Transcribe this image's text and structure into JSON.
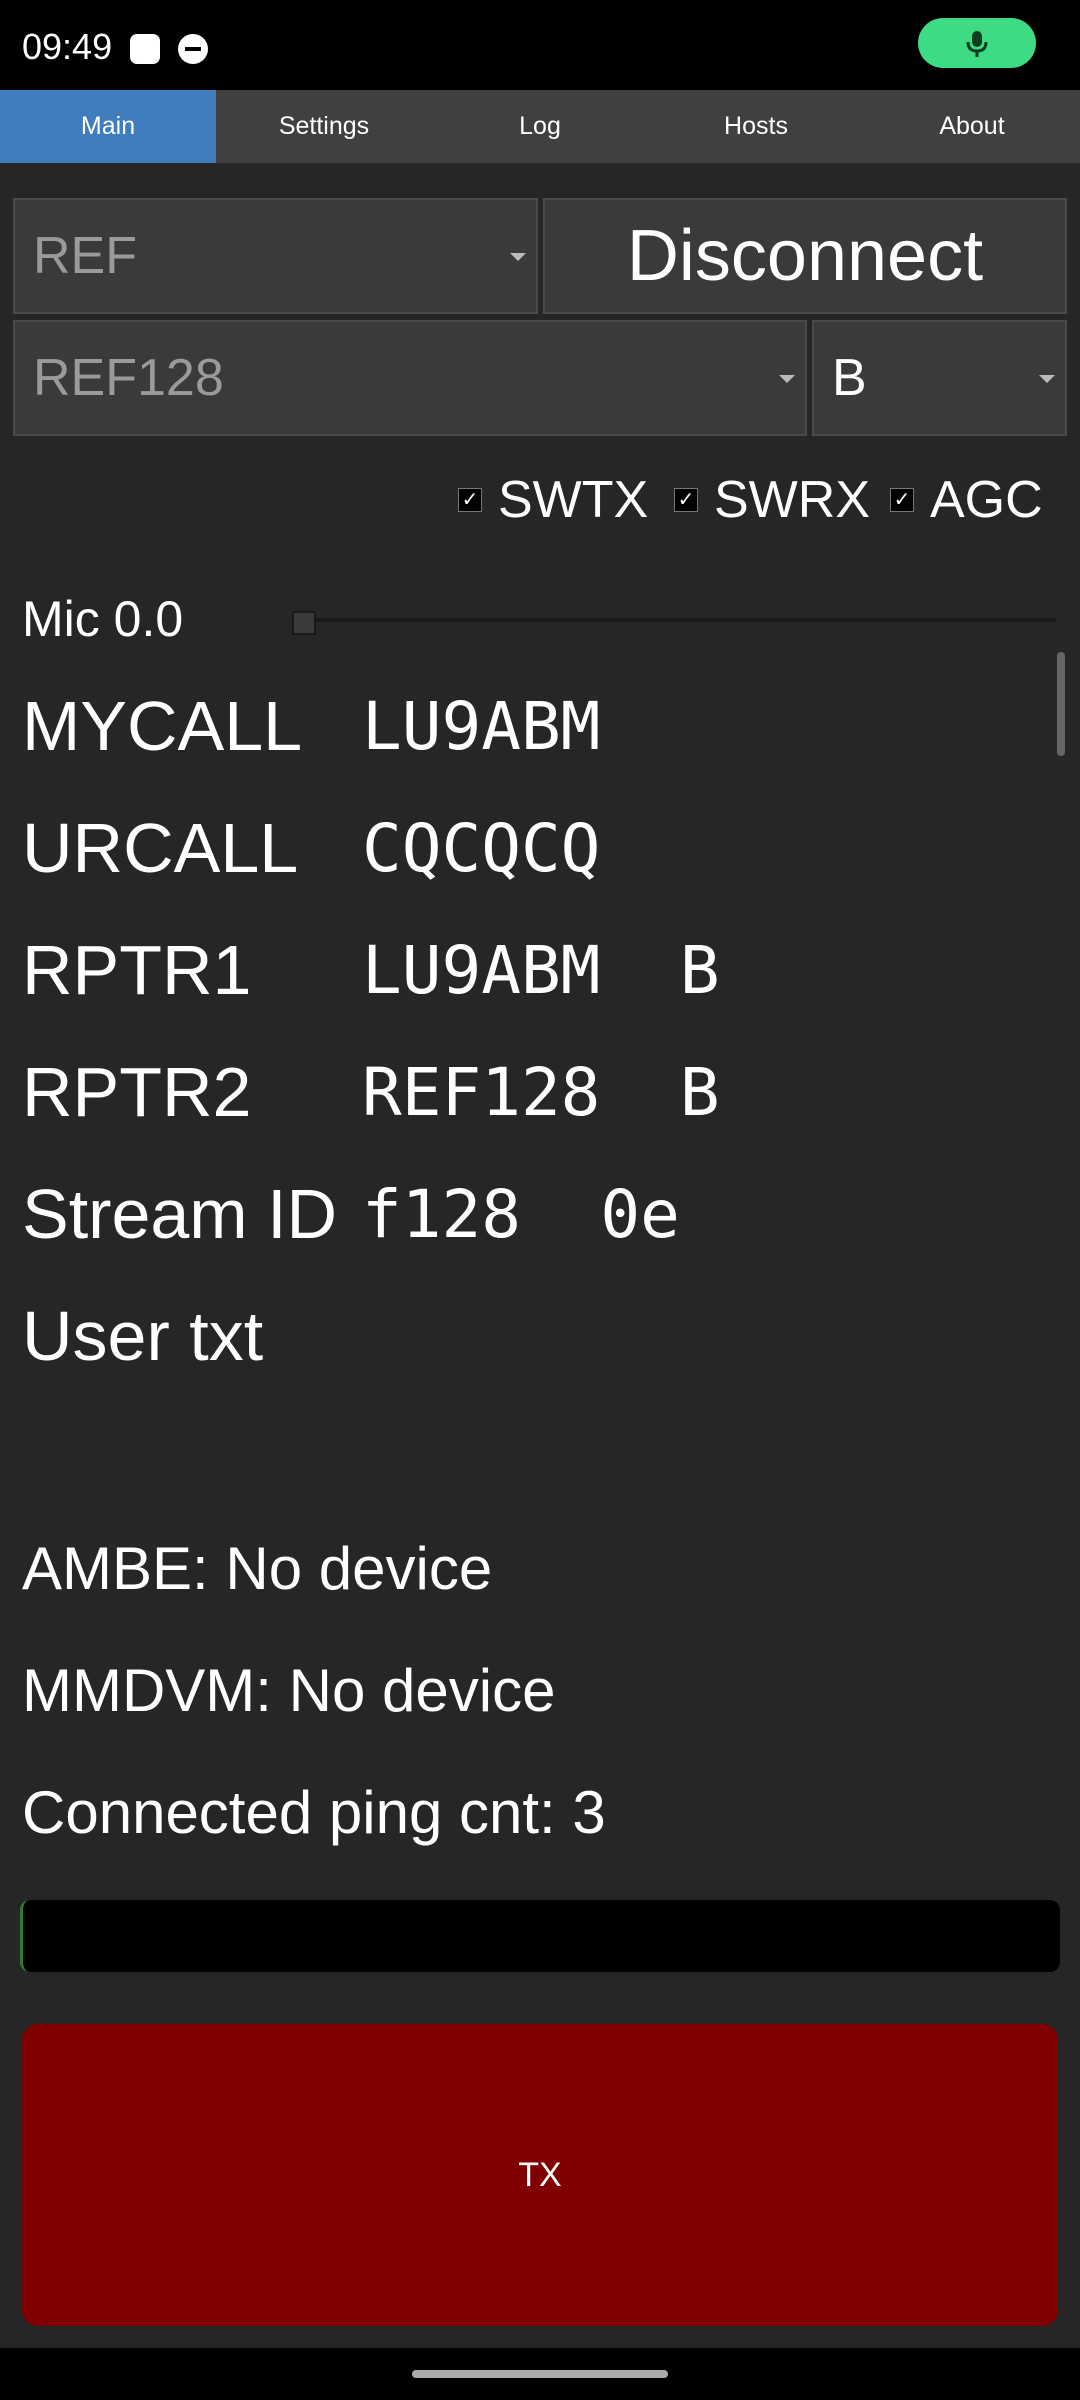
{
  "status_bar": {
    "time": "09:49"
  },
  "tabs": [
    {
      "label": "Main"
    },
    {
      "label": "Settings"
    },
    {
      "label": "Log"
    },
    {
      "label": "Hosts"
    },
    {
      "label": "About"
    }
  ],
  "active_tab": "Main",
  "controls": {
    "host_type": {
      "value": "REF"
    },
    "connect_button": "Disconnect",
    "reflector": {
      "value": "REF128"
    },
    "module": {
      "value": "B"
    },
    "checkboxes": [
      {
        "label": "SWTX",
        "checked": true
      },
      {
        "label": "SWRX",
        "checked": true
      },
      {
        "label": "AGC",
        "checked": true
      }
    ],
    "mic": {
      "label": "Mic 0.0",
      "level": 0.0
    }
  },
  "info": [
    {
      "label": "MYCALL",
      "value": "LU9ABM"
    },
    {
      "label": "URCALL",
      "value": "CQCQCQ"
    },
    {
      "label": "RPTR1",
      "value": "LU9ABM  B"
    },
    {
      "label": "RPTR2",
      "value": "REF128  B"
    },
    {
      "label": "Stream ID",
      "value": "f128  0e"
    },
    {
      "label": "User txt",
      "value": ""
    }
  ],
  "status": {
    "ambe": "AMBE: No device",
    "mmdvm": "MMDVM: No device",
    "ping": "Connected ping cnt: 3"
  },
  "tx_button": "TX",
  "colors": {
    "background": "#262626",
    "active_tab": "#3f7dbc",
    "tab_bar": "#404040",
    "tx_button": "#800000",
    "mic_pill": "#3ddc84"
  }
}
